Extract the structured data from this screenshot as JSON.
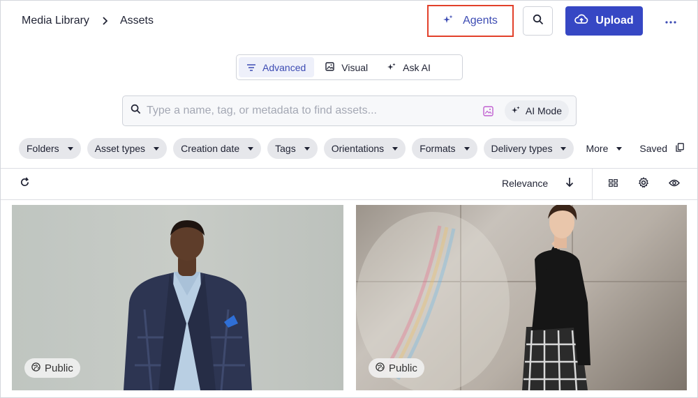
{
  "header": {
    "breadcrumb": {
      "root": "Media Library",
      "current": "Assets"
    },
    "agents_label": "Agents",
    "upload_label": "Upload"
  },
  "modes": [
    {
      "label": "Advanced",
      "icon": "filter-lines-icon",
      "active": true
    },
    {
      "label": "Visual",
      "icon": "image-search-icon",
      "active": false
    },
    {
      "label": "Ask AI",
      "icon": "sparkle-icon",
      "active": false
    }
  ],
  "search": {
    "placeholder": "Type a name, tag, or metadata to find assets...",
    "value": "",
    "ai_mode_label": "AI Mode"
  },
  "filters": [
    {
      "label": "Folders"
    },
    {
      "label": "Asset types"
    },
    {
      "label": "Creation date"
    },
    {
      "label": "Tags"
    },
    {
      "label": "Orientations"
    },
    {
      "label": "Formats"
    },
    {
      "label": "Delivery types"
    }
  ],
  "filters_more_label": "More",
  "saved_label": "Saved",
  "toolbar": {
    "sort_label": "Relevance"
  },
  "assets": [
    {
      "badge": "Public",
      "subject": "man in plaid blazer"
    },
    {
      "badge": "Public",
      "subject": "woman in black top and plaid skirt"
    }
  ],
  "colors": {
    "accent": "#3647c4",
    "accent_text": "#3c4bb3",
    "highlight_border": "#e2402a",
    "chip_bg": "#e6e7eb"
  }
}
